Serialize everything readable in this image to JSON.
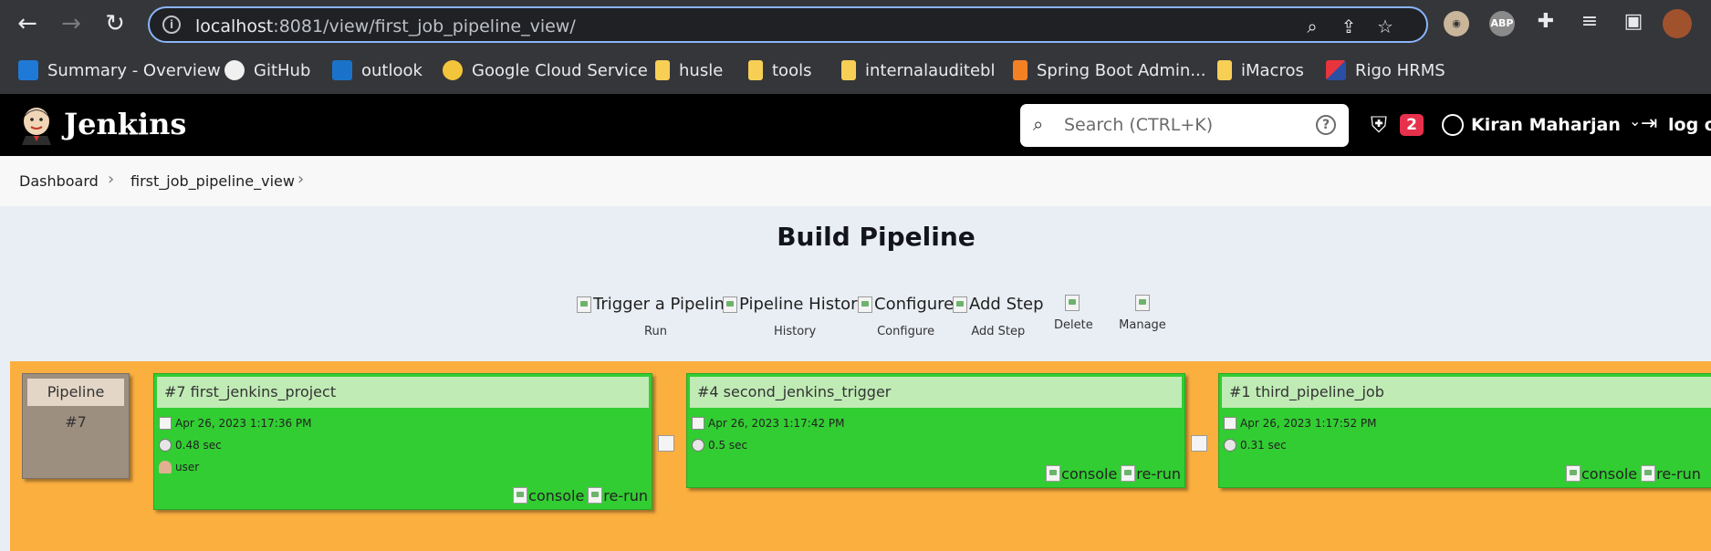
{
  "browser": {
    "url_host": "localhost",
    "url_path": ":8081/view/first_job_pipeline_view/",
    "bookmarks": [
      {
        "label": "Summary - Overview",
        "icon": "azure-devops-icon"
      },
      {
        "label": "GitHub",
        "icon": "github-icon"
      },
      {
        "label": "outlook",
        "icon": "outlook-icon"
      },
      {
        "label": "Google Cloud Service",
        "icon": "google-cloud-icon"
      },
      {
        "label": "husle",
        "icon": "folder-icon"
      },
      {
        "label": "tools",
        "icon": "folder-icon"
      },
      {
        "label": "internalauditebl",
        "icon": "folder-icon"
      },
      {
        "label": "Spring Boot Admin...",
        "icon": "stackoverflow-icon"
      },
      {
        "label": "iMacros",
        "icon": "folder-icon"
      },
      {
        "label": "Rigo HRMS",
        "icon": "rigo-icon"
      }
    ],
    "extensions": {
      "abp": "ABP"
    }
  },
  "jenkins": {
    "title": "Jenkins",
    "search_placeholder": "Search (CTRL+K)",
    "alert_count": "2",
    "user_name": "Kiran Maharjan",
    "logout_label": "log out"
  },
  "breadcrumb": [
    "Dashboard",
    "first_job_pipeline_view"
  ],
  "page_title": "Build Pipeline",
  "actions": [
    {
      "alt": "Trigger a Pipeline",
      "label": "Run"
    },
    {
      "alt": "Pipeline History",
      "label": "History"
    },
    {
      "alt": "Configure",
      "label": "Configure"
    },
    {
      "alt": "Add Step",
      "label": "Add Step"
    },
    {
      "alt": "",
      "label": "Delete"
    },
    {
      "alt": "",
      "label": "Manage"
    }
  ],
  "pipeline": {
    "label": "Pipeline",
    "number": "#7",
    "jobs": [
      {
        "title": "#7 first_jenkins_project",
        "date": "Apr 26, 2023 1:17:36 PM",
        "duration": "0.48 sec",
        "user": "user",
        "console": "console",
        "rerun": "re-run"
      },
      {
        "title": "#4 second_jenkins_trigger",
        "date": "Apr 26, 2023 1:17:42 PM",
        "duration": "0.5 sec",
        "console": "console",
        "rerun": "re-run"
      },
      {
        "title": "#1 third_pipeline_job",
        "date": "Apr 26, 2023 1:17:52 PM",
        "duration": "0.31 sec",
        "console": "console",
        "rerun": "re-run"
      }
    ]
  },
  "colors": {
    "pipeline_area": "#fbaf3f",
    "job_success": "#32cd32",
    "job_title_bg": "#c0ebb5",
    "alert_badge": "#e6304c"
  }
}
